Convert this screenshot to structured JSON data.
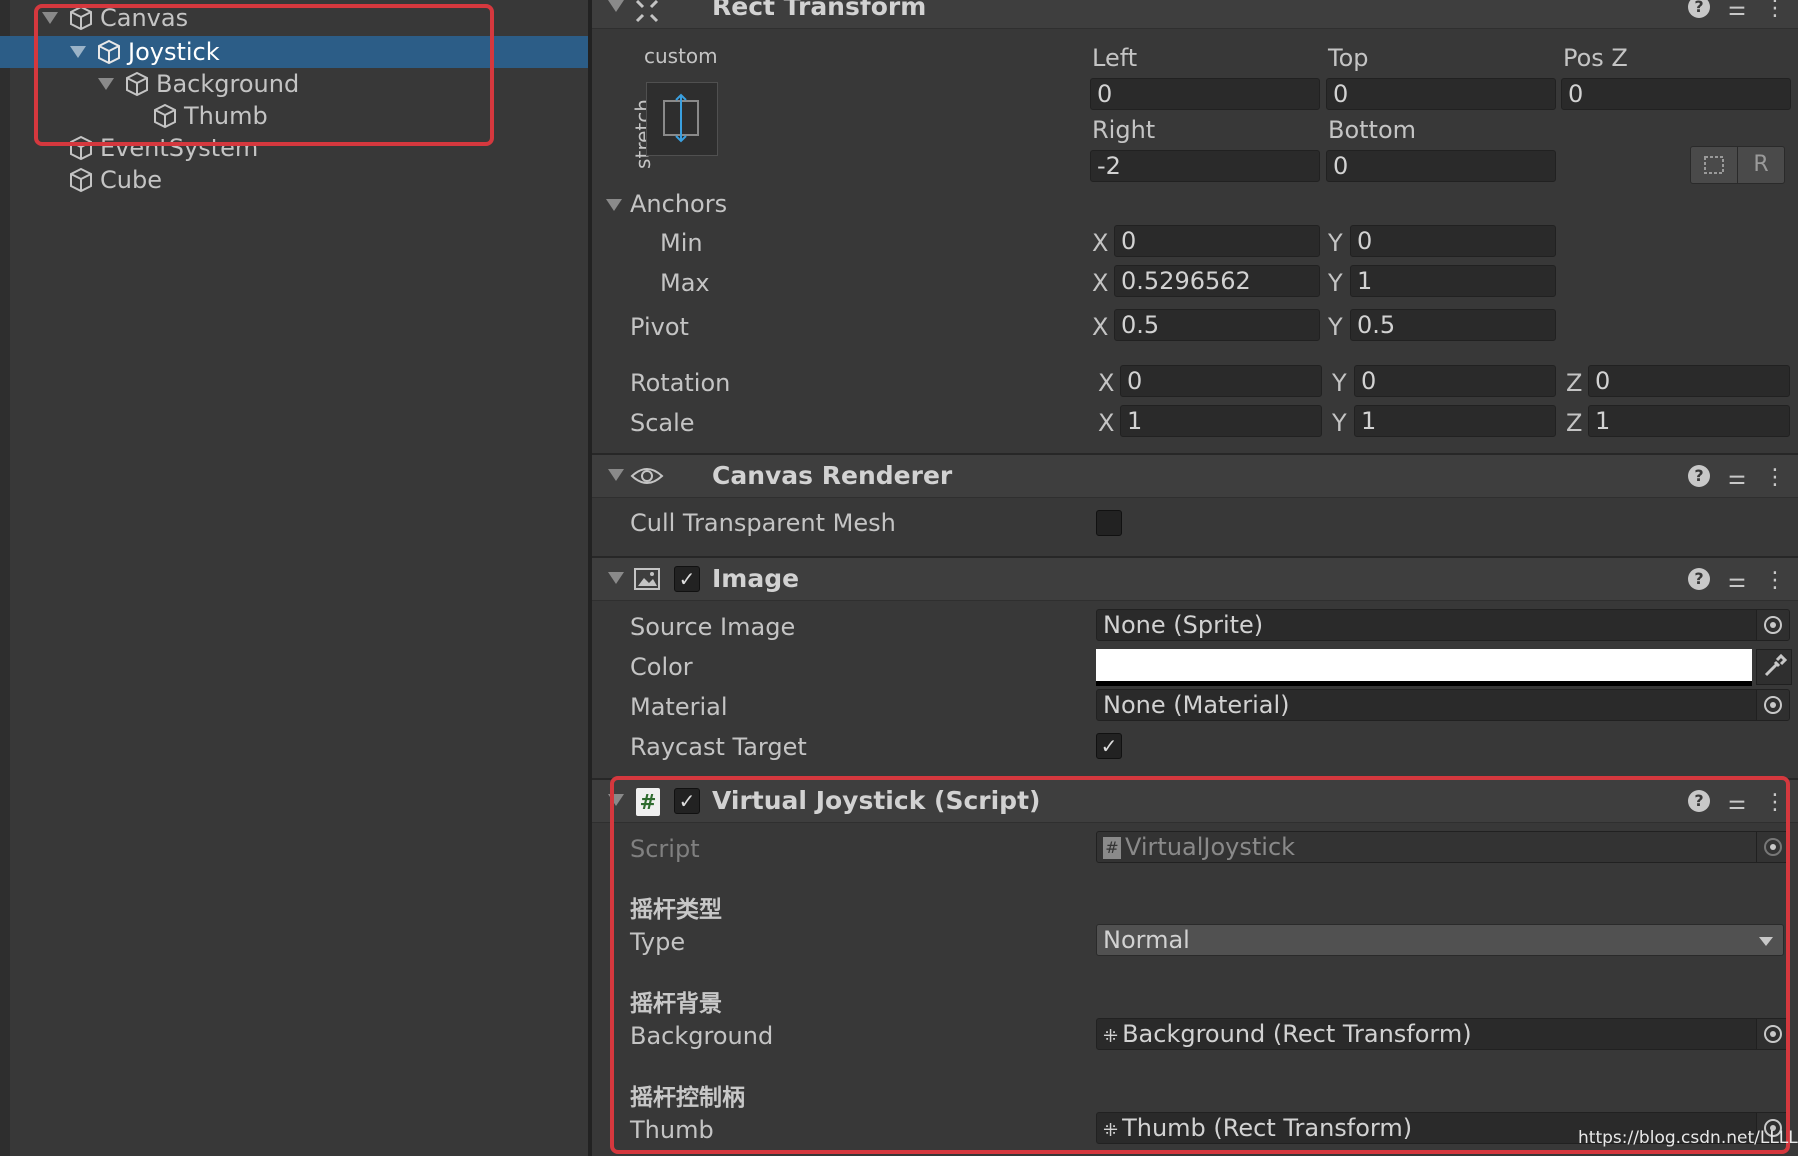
{
  "hierarchy": {
    "items": [
      {
        "label": "Canvas"
      },
      {
        "label": "Joystick"
      },
      {
        "label": "Background"
      },
      {
        "label": "Thumb"
      },
      {
        "label": "EventSystem"
      },
      {
        "label": "Cube"
      }
    ]
  },
  "rect_transform": {
    "title": "Rect Transform",
    "anchor_preset_top": "custom",
    "anchor_preset_side": "stretch",
    "left_label": "Left",
    "left_value": "0",
    "top_label": "Top",
    "top_value": "0",
    "posz_label": "Pos Z",
    "posz_value": "0",
    "right_label": "Right",
    "right_value": "-2",
    "bottom_label": "Bottom",
    "bottom_value": "0",
    "raw_button": "R",
    "anchors_label": "Anchors",
    "min_label": "Min",
    "min_x": "0",
    "min_y": "0",
    "max_label": "Max",
    "max_x": "0.5296562",
    "max_y": "1",
    "pivot_label": "Pivot",
    "pivot_x": "0.5",
    "pivot_y": "0.5",
    "rotation_label": "Rotation",
    "rot_x": "0",
    "rot_y": "0",
    "rot_z": "0",
    "scale_label": "Scale",
    "scale_x": "1",
    "scale_y": "1",
    "scale_z": "1",
    "axis_x": "X",
    "axis_y": "Y",
    "axis_z": "Z"
  },
  "canvas_renderer": {
    "title": "Canvas Renderer",
    "cull_label": "Cull Transparent Mesh"
  },
  "image": {
    "title": "Image",
    "source_label": "Source Image",
    "source_value": "None (Sprite)",
    "color_label": "Color",
    "color_value": "#ffffff",
    "material_label": "Material",
    "material_value": "None (Material)",
    "raycast_label": "Raycast Target"
  },
  "virtual_joystick": {
    "title": "Virtual Joystick (Script)",
    "script_label": "Script",
    "script_value": "VirtualJoystick",
    "type_header": "摇杆类型",
    "type_label": "Type",
    "type_value": "Normal",
    "bg_header": "摇杆背景",
    "bg_label": "Background",
    "bg_value": "Background (Rect Transform)",
    "thumb_header": "摇杆控制柄",
    "thumb_label": "Thumb",
    "thumb_value": "Thumb (Rect Transform)"
  },
  "watermark": "https://blog.csdn.net/LLLLL",
  "colors": {
    "selection": "#2c5d87",
    "highlight_box": "#d5383e"
  }
}
